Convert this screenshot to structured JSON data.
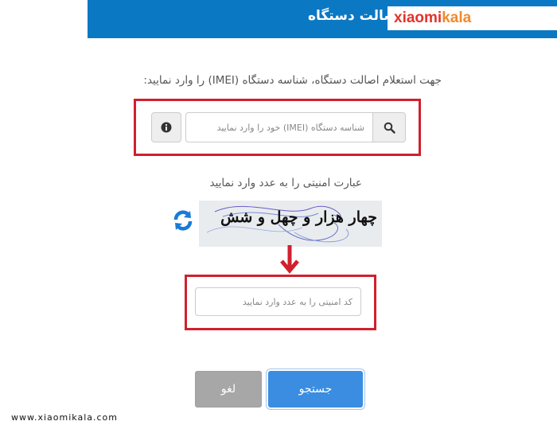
{
  "header": {
    "title": "استعلام اصالت دستگاه",
    "logo_part1": "xiaomi",
    "logo_part2": "kala"
  },
  "form": {
    "instruction": "جهت استعلام اصالت دستگاه، شناسه دستگاه (IMEI) را وارد نمایید:",
    "imei_placeholder": "شناسه دستگاه (IMEI) خود را وارد نمایید",
    "imei_value": "",
    "captcha_label": "عبارت امنیتی را به عدد وارد نمایید",
    "captcha_text": "چهار هزار و چهل و شش",
    "captcha_placeholder": "کد امنیتی را به عدد وارد نمایید",
    "captcha_value": ""
  },
  "buttons": {
    "submit": "جستجو",
    "cancel": "لغو"
  },
  "footer": {
    "site": "www.xiaomikala.com"
  },
  "colors": {
    "header_bg": "#0b78c4",
    "highlight_red": "#d0202e",
    "submit_blue": "#3a8de0",
    "cancel_gray": "#a7a7a7",
    "refresh_blue": "#1a7bd6"
  },
  "icons": {
    "search": "search-icon",
    "info": "info-icon",
    "refresh": "refresh-icon",
    "arrow": "arrow-down-icon"
  }
}
